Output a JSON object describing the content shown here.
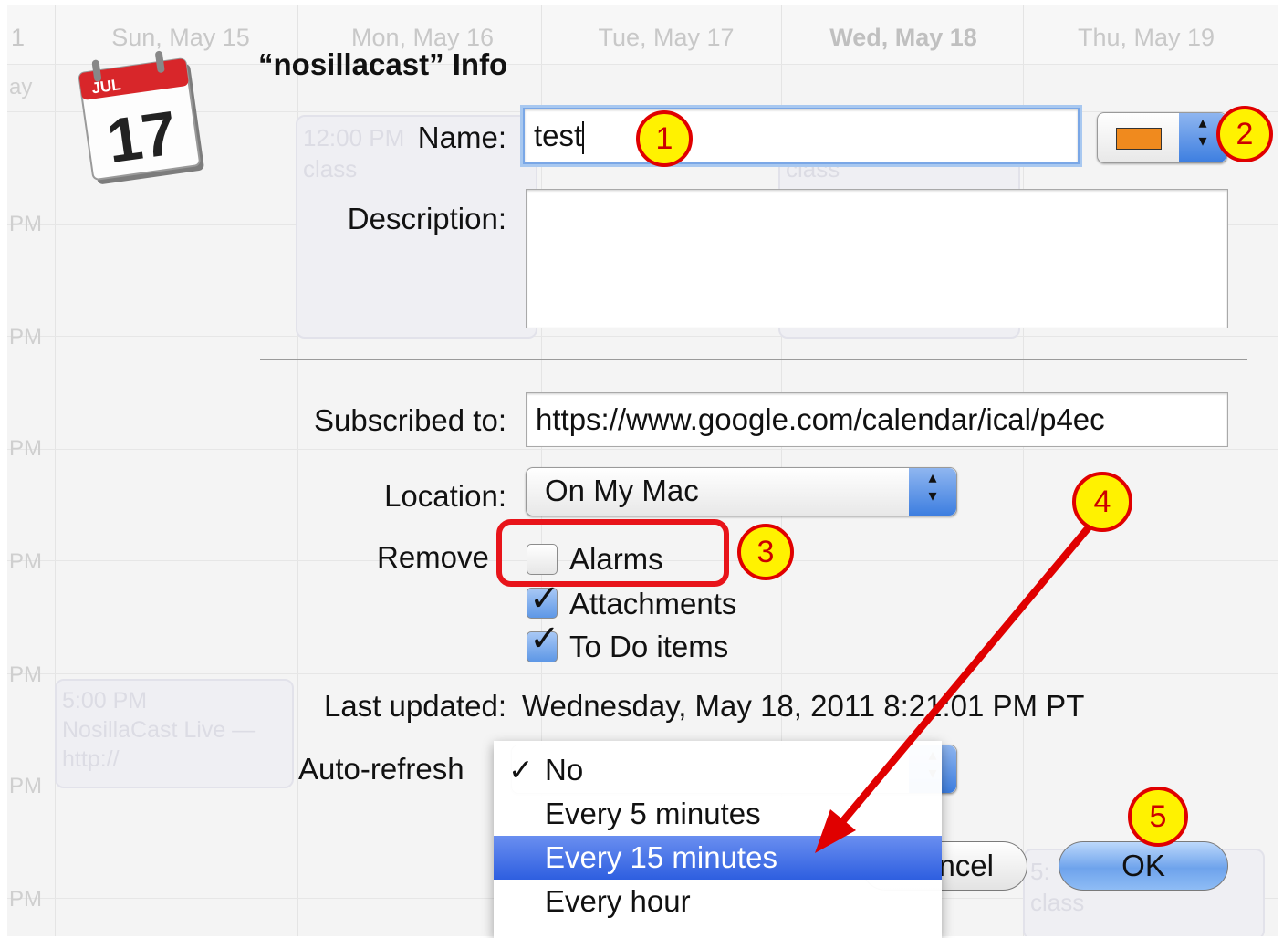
{
  "background": {
    "day_headers": [
      "1",
      "Sun, May 15",
      "Mon, May 16",
      "Tue, May 17",
      "Wed, May 18",
      "Thu, May 19"
    ],
    "row_labels": [
      "ay",
      "PM",
      "PM",
      "PM",
      "PM",
      "PM",
      "PM",
      "PM"
    ],
    "events": {
      "class_1_time": "12:00 PM",
      "class_1_title": "class",
      "class_2_title": "class",
      "live_time": "5:00 PM",
      "live_title": "NosillaCast Live —",
      "live_url": "http://",
      "class_3_time": "5:",
      "class_3_title": "class"
    }
  },
  "dialog": {
    "title": "“nosillacast” Info",
    "icon_month": "JUL",
    "icon_day": "17",
    "name_label": "Name:",
    "name_value": "test",
    "description_label": "Description:",
    "description_value": "",
    "subscribed_label": "Subscribed to:",
    "subscribed_value": "https://www.google.com/calendar/ical/p4ec",
    "location_label": "Location:",
    "location_value": "On My Mac",
    "remove_label": "Remove",
    "remove_options": [
      {
        "label": "Alarms",
        "checked": false
      },
      {
        "label": "Attachments",
        "checked": true
      },
      {
        "label": "To Do items",
        "checked": true
      }
    ],
    "last_updated_label": "Last updated:",
    "last_updated_value": "Wednesday, May 18, 2011 8:21:01 PM PT",
    "auto_refresh_label": "Auto-refresh",
    "color_swatch": "#f08a1e",
    "cancel_label": "ncel",
    "ok_label": "OK"
  },
  "auto_refresh_menu": {
    "items": [
      {
        "label": "No",
        "checked": true,
        "selected": false
      },
      {
        "label": "Every 5 minutes",
        "checked": false,
        "selected": false
      },
      {
        "label": "Every 15 minutes",
        "checked": false,
        "selected": true
      },
      {
        "label": "Every hour",
        "checked": false,
        "selected": false
      }
    ],
    "check_mark": "✓"
  },
  "annotations": {
    "badges": [
      "1",
      "2",
      "3",
      "4",
      "5"
    ],
    "color": "#e00000",
    "fill": "#fff200"
  }
}
